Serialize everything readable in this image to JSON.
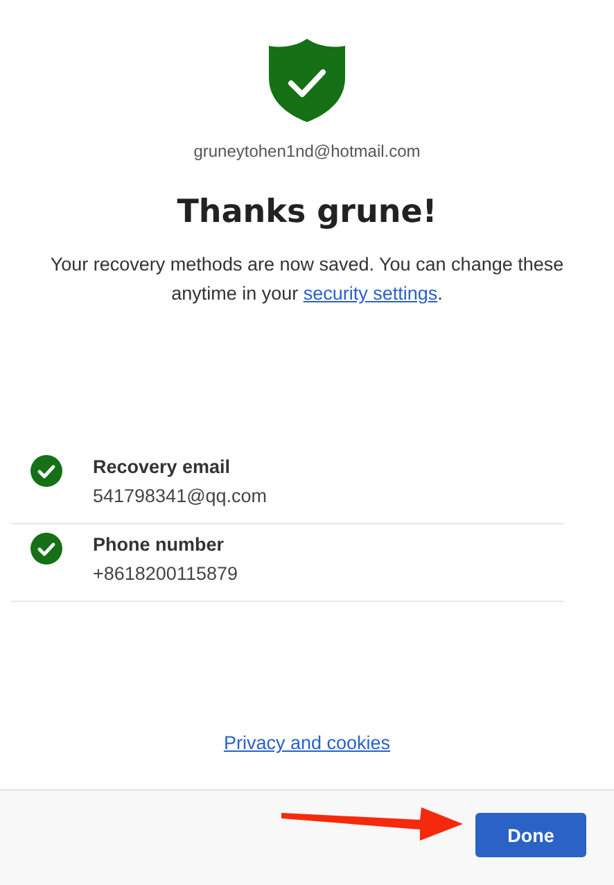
{
  "account": {
    "email": "gruneytohen1nd@hotmail.com"
  },
  "title": "Thanks grune!",
  "message": {
    "text": "Your recovery methods are now saved. You can change these anytime in your ",
    "link": "security settings",
    "after": "."
  },
  "methods": [
    {
      "label": "Recovery email",
      "value": "541798341@qq.com"
    },
    {
      "label": "Phone number",
      "value": "+8618200115879"
    }
  ],
  "privacy_link": "Privacy and cookies",
  "footer": {
    "button": "Done"
  }
}
